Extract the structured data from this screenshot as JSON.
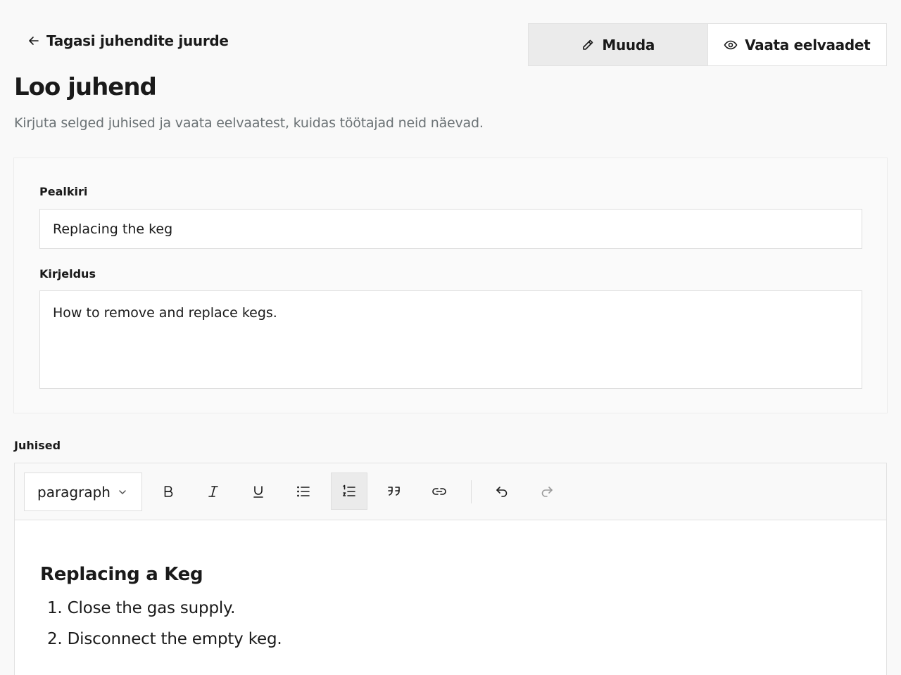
{
  "nav": {
    "back_label": "Tagasi juhendite juurde"
  },
  "mode_toggle": {
    "edit_label": "Muuda",
    "preview_label": "Vaata eelvaadet",
    "active": "edit"
  },
  "header": {
    "title": "Loo juhend",
    "subtitle": "Kirjuta selged juhised ja vaata eelvaatest, kuidas töötajad neid näevad."
  },
  "form": {
    "title_label": "Pealkiri",
    "title_value": "Replacing the keg",
    "description_label": "Kirjeldus",
    "description_value": "How to remove and replace kegs."
  },
  "editor": {
    "section_label": "Juhised",
    "block_type": "paragraph",
    "toolbar": [
      {
        "name": "bold",
        "icon": "bold-icon",
        "active": false
      },
      {
        "name": "italic",
        "icon": "italic-icon",
        "active": false
      },
      {
        "name": "underline",
        "icon": "underline-icon",
        "active": false
      },
      {
        "name": "bullet-list",
        "icon": "bullet-list-icon",
        "active": false
      },
      {
        "name": "ordered-list",
        "icon": "ordered-list-icon",
        "active": true
      },
      {
        "name": "quote",
        "icon": "quote-icon",
        "active": false
      },
      {
        "name": "link",
        "icon": "link-icon",
        "active": false
      },
      {
        "name": "undo",
        "icon": "undo-icon",
        "active": false
      },
      {
        "name": "redo",
        "icon": "redo-icon",
        "active": false
      }
    ],
    "content": {
      "heading": "Replacing a Keg",
      "steps": [
        {
          "number": "1.",
          "text": "Close the gas supply."
        },
        {
          "number": "2.",
          "text": "Disconnect the empty keg."
        }
      ]
    }
  },
  "colors": {
    "page_background": "#f9f9f9",
    "text": "#1a1a1a",
    "muted_text": "#6b7275",
    "border": "#e2e2e2",
    "active_button": "#ebebeb"
  }
}
